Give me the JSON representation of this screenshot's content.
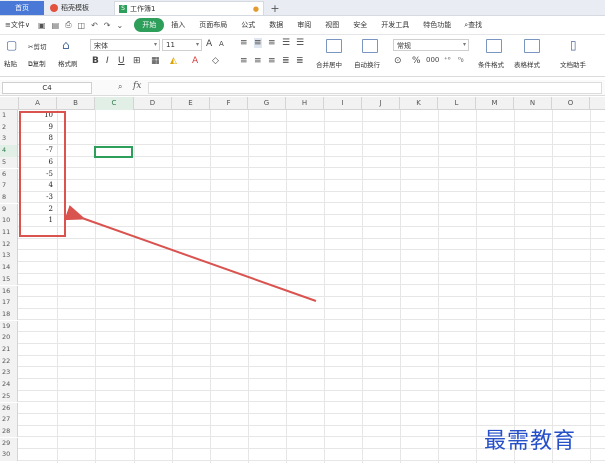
{
  "tabs": {
    "home": "首页",
    "template": "稻壳模板",
    "document": "工作簿1",
    "new_tab": "+"
  },
  "menu": {
    "file": "文件",
    "items": [
      "开始",
      "插入",
      "页面布局",
      "公式",
      "数据",
      "审阅",
      "视图",
      "安全",
      "开发工具",
      "特色功能"
    ],
    "search": "查找"
  },
  "ribbon": {
    "cut": "剪切",
    "paste": "粘贴",
    "copy": "复制",
    "format_painter": "格式刷",
    "font_name": "宋体",
    "font_size": "11",
    "merge_center": "合并居中",
    "wrap": "自动换行",
    "number_format": "常规",
    "cond_format": "条件格式",
    "table_style": "表格样式",
    "doc_helper": "文档助手"
  },
  "formula_bar": {
    "name_box": "C4",
    "fx": "fx",
    "formula": ""
  },
  "columns": [
    "A",
    "B",
    "C",
    "D",
    "E",
    "F",
    "G",
    "H",
    "I",
    "J",
    "K",
    "L",
    "M",
    "N",
    "O"
  ],
  "selected_column": "C",
  "selected_row": 4,
  "row_count": 30,
  "cells_a": [
    "10",
    "9",
    "8",
    "-7",
    "6",
    "-5",
    "4",
    "-3",
    "2",
    "1"
  ],
  "watermark": "最需教育",
  "colors": {
    "accent": "#2e9e5b",
    "highlight": "#d9534f",
    "home_tab": "#4a78d6",
    "watermark": "#2550c9"
  }
}
